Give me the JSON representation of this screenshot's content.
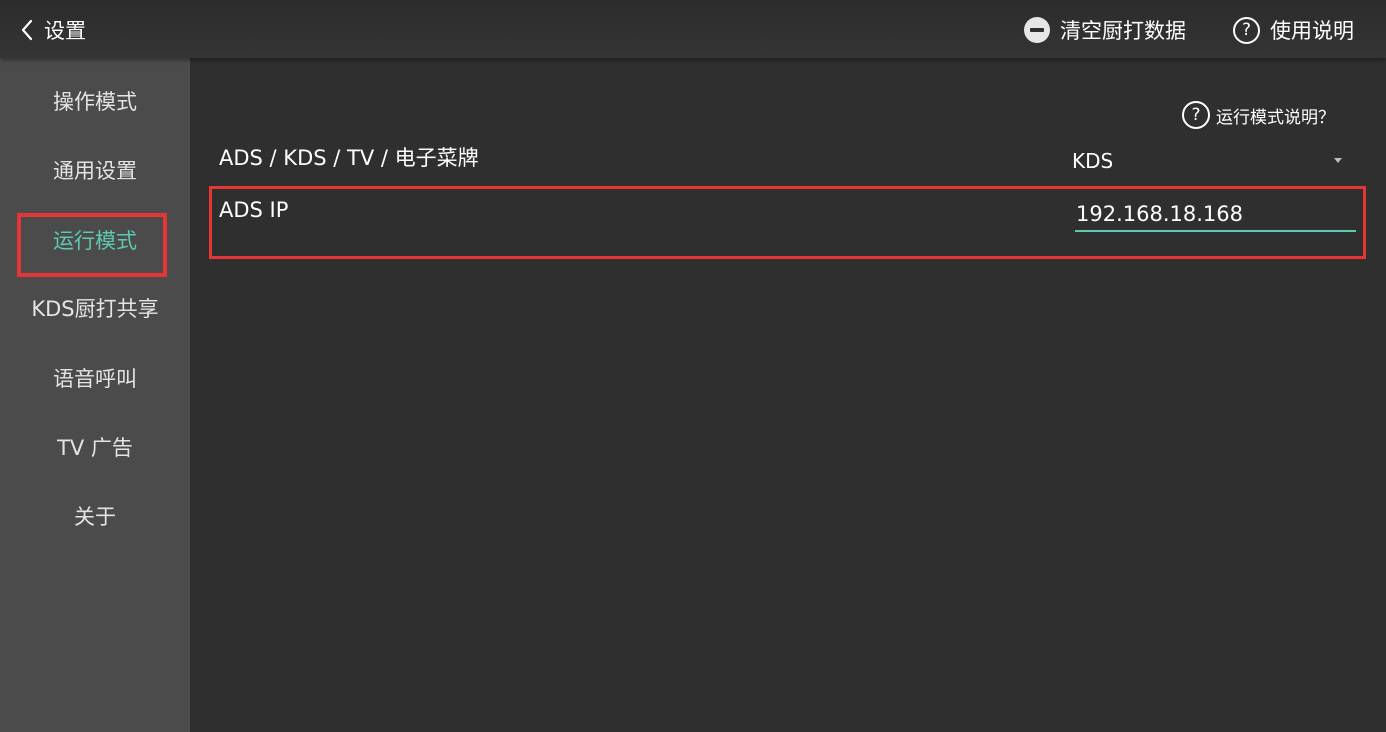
{
  "header": {
    "back_label": "设置",
    "clear_label": "清空厨打数据",
    "help_label": "使用说明"
  },
  "sidebar": {
    "items": [
      {
        "label": "操作模式"
      },
      {
        "label": "通用设置"
      },
      {
        "label": "运行模式"
      },
      {
        "label": "KDS厨打共享"
      },
      {
        "label": "语音呼叫"
      },
      {
        "label": "TV 广告"
      },
      {
        "label": "关于"
      }
    ],
    "active_index": 2
  },
  "main": {
    "mode_help_icon": "?",
    "mode_help_label": "运行模式说明？",
    "mode_row": {
      "label": "ADS / KDS / TV / 电子菜牌",
      "value": "KDS"
    },
    "ip_row": {
      "label": "ADS IP",
      "value": "192.168.18.168"
    }
  },
  "colors": {
    "accent": "#5cc9b0",
    "highlight_border": "#e53535",
    "sidebar_bg": "#4b4b4b",
    "content_bg": "#2f2f2f"
  },
  "icons": {
    "back": "chevron-left-icon",
    "clear": "minus-circle-icon",
    "help": "question-circle-icon",
    "dropdown": "caret-down-icon"
  }
}
